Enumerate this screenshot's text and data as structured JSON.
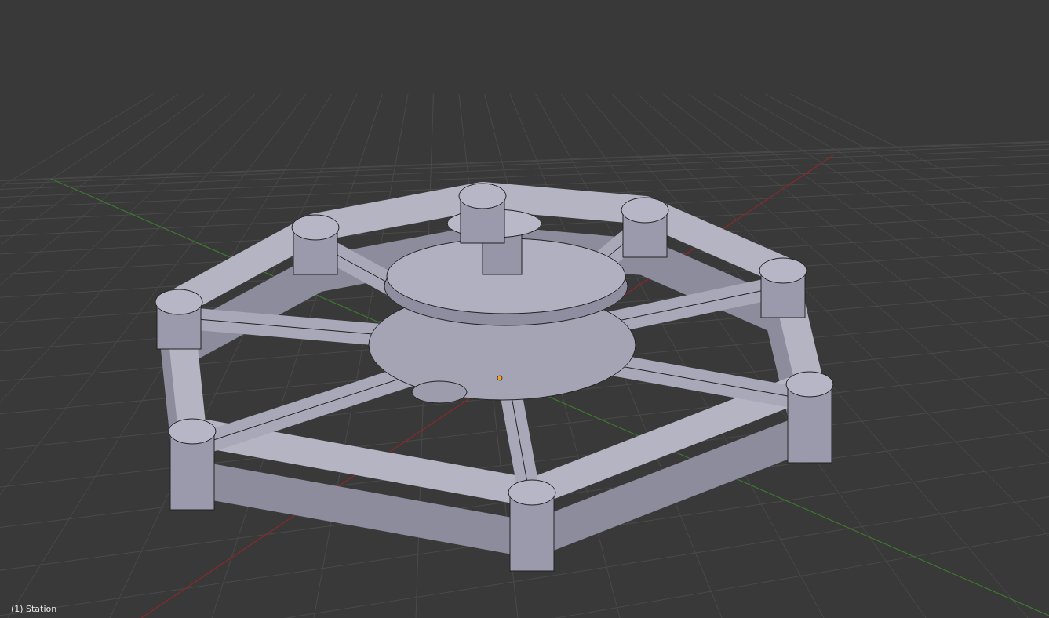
{
  "viewport": {
    "object_label": "(1) Station"
  }
}
